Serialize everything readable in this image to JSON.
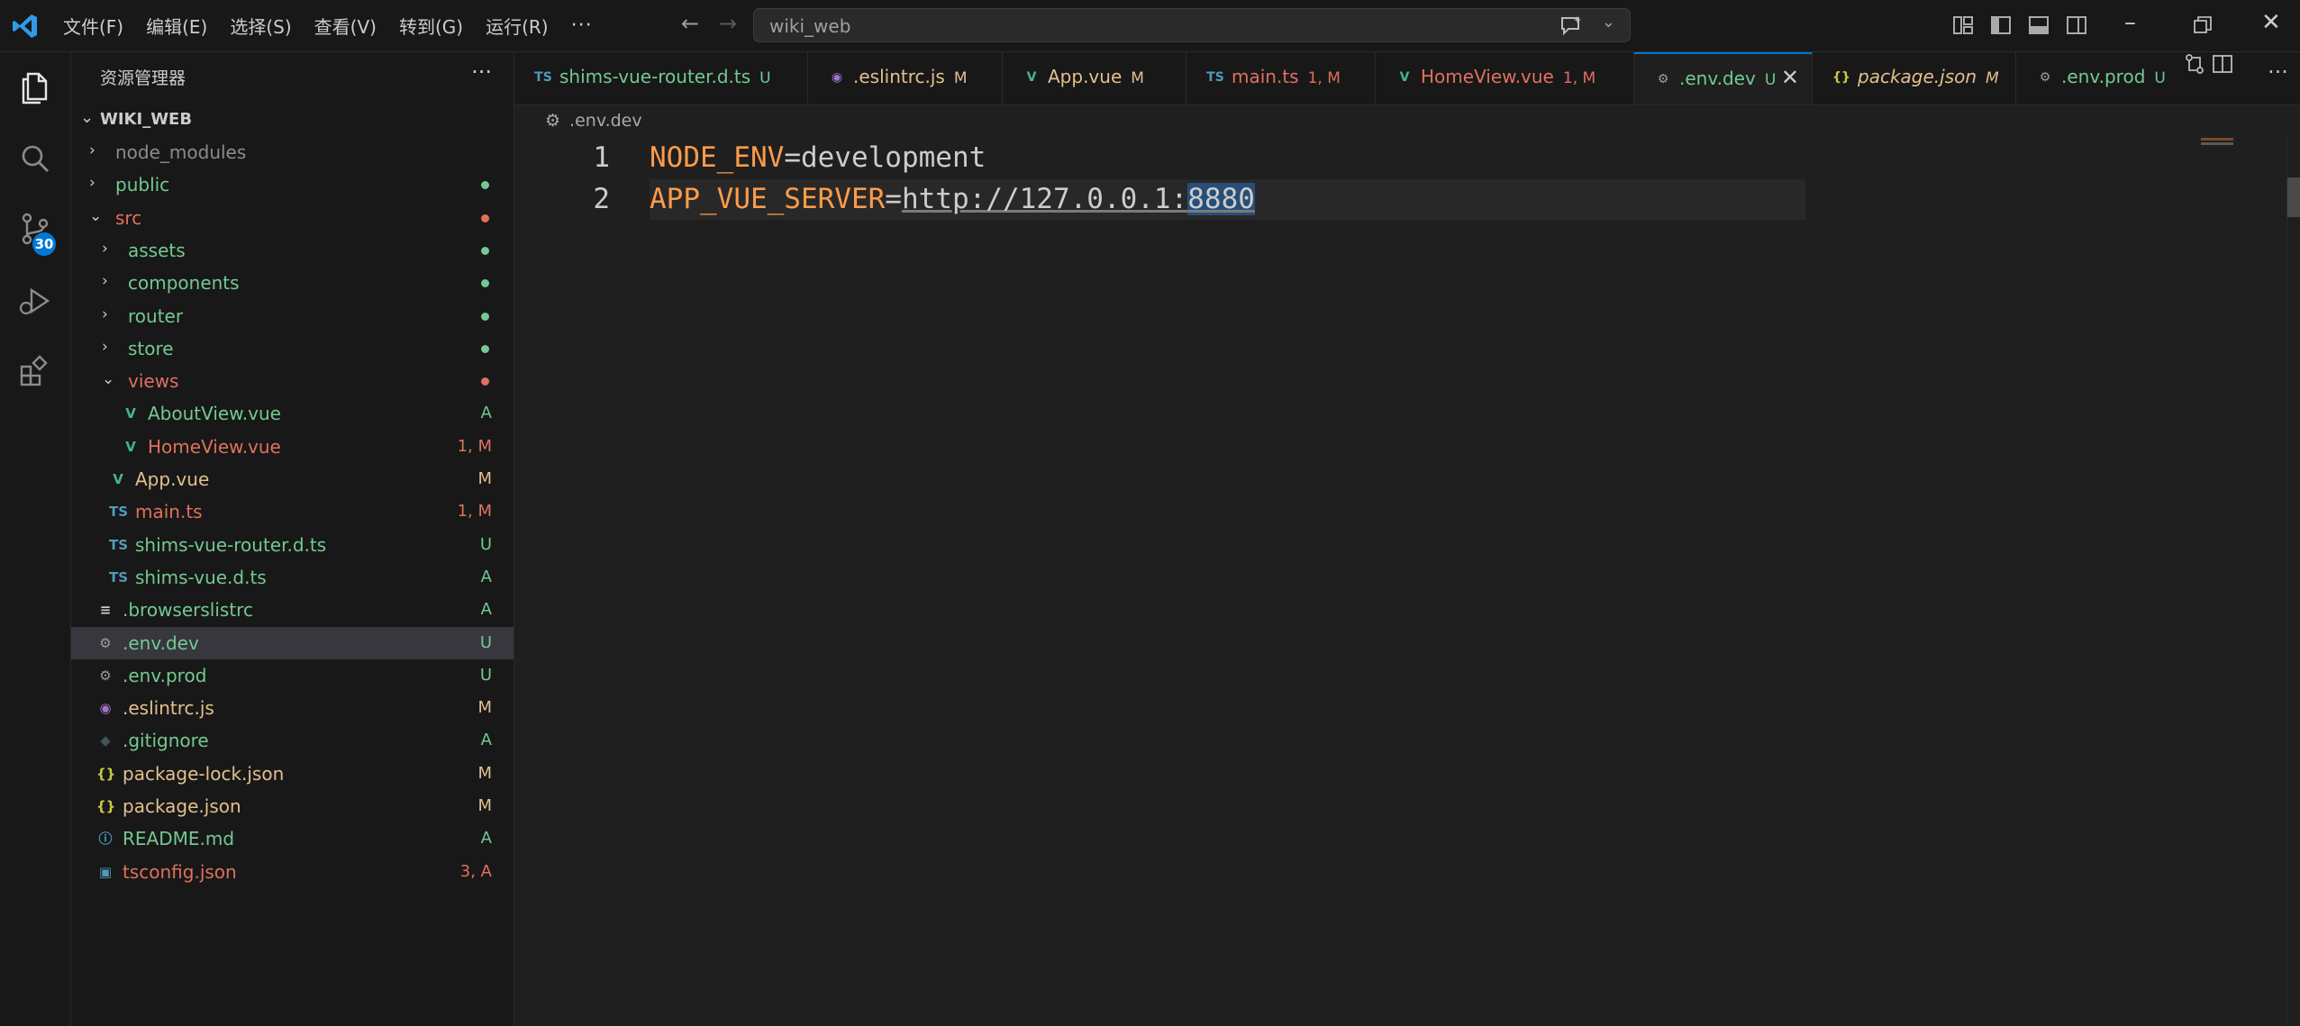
{
  "titlebar": {
    "menus": [
      "文件(F)",
      "编辑(E)",
      "选择(S)",
      "查看(V)",
      "转到(G)",
      "运行(R)"
    ],
    "more": "···",
    "search_text": "wiki_web"
  },
  "activity": {
    "scm_badge": "30"
  },
  "sidebar": {
    "title": "资源管理器",
    "more": "···",
    "project": "WIKI_WEB",
    "items": [
      {
        "name": "node_modules",
        "status": "",
        "color": "#8b8b8b"
      },
      {
        "name": "public",
        "status": "",
        "color": "#73c991"
      },
      {
        "name": "src",
        "status": "",
        "color": "#e0705e"
      },
      {
        "name": "assets",
        "status": "",
        "color": "#73c991"
      },
      {
        "name": "components",
        "status": "",
        "color": "#73c991"
      },
      {
        "name": "router",
        "status": "",
        "color": "#73c991"
      },
      {
        "name": "store",
        "status": "",
        "color": "#73c991"
      },
      {
        "name": "views",
        "status": "",
        "color": "#e0705e"
      },
      {
        "name": "AboutView.vue",
        "status": "A",
        "color": "#73c991"
      },
      {
        "name": "HomeView.vue",
        "status": "1, M",
        "color": "#e0705e"
      },
      {
        "name": "App.vue",
        "status": "M",
        "color": "#e2c08d"
      },
      {
        "name": "main.ts",
        "status": "1, M",
        "color": "#e0705e"
      },
      {
        "name": "shims-vue-router.d.ts",
        "status": "U",
        "color": "#73c991"
      },
      {
        "name": "shims-vue.d.ts",
        "status": "A",
        "color": "#73c991"
      },
      {
        "name": ".browserslistrc",
        "status": "A",
        "color": "#73c991"
      },
      {
        "name": ".env.dev",
        "status": "U",
        "color": "#73c991"
      },
      {
        "name": ".env.prod",
        "status": "U",
        "color": "#73c991"
      },
      {
        "name": ".eslintrc.js",
        "status": "M",
        "color": "#e2c08d"
      },
      {
        "name": ".gitignore",
        "status": "A",
        "color": "#73c991"
      },
      {
        "name": "package-lock.json",
        "status": "M",
        "color": "#e2c08d"
      },
      {
        "name": "package.json",
        "status": "M",
        "color": "#e2c08d"
      },
      {
        "name": "README.md",
        "status": "A",
        "color": "#73c991"
      },
      {
        "name": "tsconfig.json",
        "status": "3, A",
        "color": "#e0705e"
      }
    ]
  },
  "tabs": [
    {
      "label": "shims-vue-router.d.ts",
      "status": "U",
      "color": "#73c991"
    },
    {
      "label": ".eslintrc.js",
      "status": "M",
      "color": "#e2c08d"
    },
    {
      "label": "App.vue",
      "status": "M",
      "color": "#e2c08d"
    },
    {
      "label": "main.ts",
      "status": "1, M",
      "color": "#e0705e"
    },
    {
      "label": "HomeView.vue",
      "status": "1, M",
      "color": "#e0705e"
    },
    {
      "label": ".env.dev",
      "status": "U",
      "color": "#73c991"
    },
    {
      "label": "package.json",
      "status": "M",
      "color": "#e2c08d"
    },
    {
      "label": ".env.prod",
      "status": "U",
      "color": "#73c991"
    }
  ],
  "editor": {
    "breadcrumb": ".env.dev",
    "lines": [
      {
        "num": "1",
        "key": "NODE_ENV",
        "eq": "=",
        "value": "development"
      },
      {
        "num": "2",
        "key": "APP_VUE_SERVER",
        "eq": "=",
        "url": "http://127.0.0.1:",
        "port": "8880"
      }
    ]
  }
}
